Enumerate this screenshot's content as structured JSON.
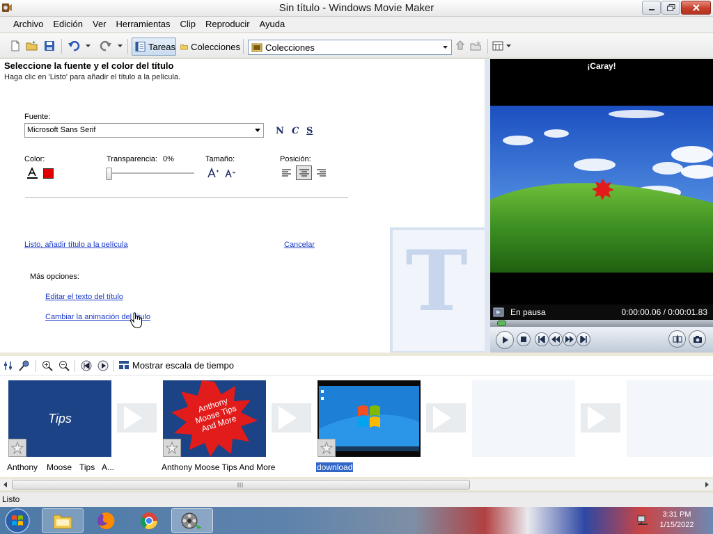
{
  "window": {
    "title": "Sin título - Windows Movie Maker"
  },
  "menu": [
    "Archivo",
    "Edición",
    "Ver",
    "Herramientas",
    "Clip",
    "Reproducir",
    "Ayuda"
  ],
  "toolbar": {
    "tasks_label": "Tareas",
    "collections_label": "Colecciones",
    "collections_dropdown_value": "Colecciones"
  },
  "task_pane": {
    "heading": "Seleccione la fuente y el color del título",
    "subheading": "Haga clic en 'Listo' para añadir el título a la película.",
    "font_label": "Fuente:",
    "font_value": "Microsoft Sans Serif",
    "style_buttons": [
      "N",
      "C",
      "S"
    ],
    "color_label": "Color:",
    "text_color": "#e00000",
    "transparency_label": "Transparencia:",
    "transparency_value": "0%",
    "transparency_level": 0,
    "size_label": "Tamaño:",
    "position_label": "Posición:",
    "position_selected": "center",
    "done_link": "Listo, añadir título a la película",
    "cancel_link": "Cancelar",
    "more_options_label": "Más opciones:",
    "edit_text_link": "Editar el texto del título",
    "change_animation_link": "Cambiar la animación del título"
  },
  "monitor": {
    "title": "¡Caray!",
    "status": "En pausa",
    "time": "0:00:00.06 / 0:00:01.83",
    "seek_fraction": 0.033
  },
  "storyboard": {
    "timeline_label": "Mostrar escala de tiempo",
    "clips": [
      {
        "label_words": [
          "Anthony",
          "Moose",
          "Tips",
          "A..."
        ],
        "thumb_text": "Tips"
      },
      {
        "label": "Anthony Moose Tips And More",
        "thumb_text": "Anthony Moose Tips And More"
      },
      {
        "label": "download",
        "selected": true
      }
    ]
  },
  "status_bar": "Listo",
  "clock": {
    "time": "3:31 PM",
    "date": "1/15/2022"
  },
  "colors": {
    "accent": "#1a3ac8",
    "selection": "#3166c8",
    "clip_blue": "#1b4385",
    "star_red": "#e21b1b"
  }
}
